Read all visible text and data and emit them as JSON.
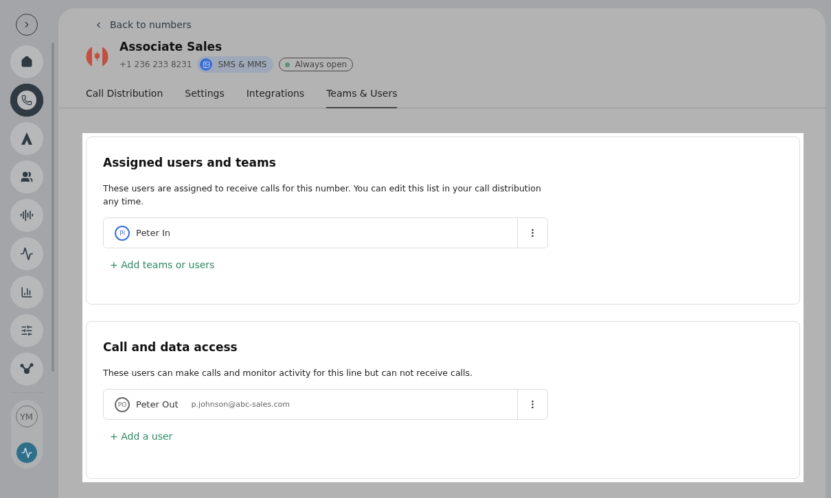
{
  "sidebar": {
    "nav": [
      {
        "selected": false
      },
      {
        "selected": true
      },
      {
        "selected": false
      },
      {
        "selected": false
      },
      {
        "selected": false
      },
      {
        "selected": false
      },
      {
        "selected": false
      },
      {
        "selected": false
      },
      {
        "selected": false
      }
    ],
    "user_avatar": {
      "initials": "YM"
    }
  },
  "header": {
    "back_link": "Back to numbers",
    "title": "Associate Sales",
    "phone": "+1 236 233 8231",
    "channel_badge": "SMS & MMS",
    "status_badge": {
      "label": "Always open",
      "color": "#5e8f79"
    }
  },
  "tabs": [
    {
      "label": "Call Distribution",
      "selected": false
    },
    {
      "label": "Settings",
      "selected": false
    },
    {
      "label": "Integrations",
      "selected": false
    },
    {
      "label": "Teams & Users",
      "selected": true
    }
  ],
  "sections": [
    {
      "title": "Assigned users and teams",
      "description": "These users are assigned to receive calls for this number. You can edit this list in your call distribution any time.",
      "users": [
        {
          "initials": "PI",
          "name": "Peter In",
          "color": "#3b6fd8"
        }
      ],
      "add_link": "+ Add teams or users"
    },
    {
      "title": "Call and data access",
      "description": "These users can make calls and monitor activity for this line but can not receive calls.",
      "users": [
        {
          "initials": "PO",
          "name": "Peter Out",
          "email": "p.johnson@abc-sales.com",
          "color": "#6b6b6b"
        }
      ],
      "add_link": "+ Add a user"
    }
  ]
}
